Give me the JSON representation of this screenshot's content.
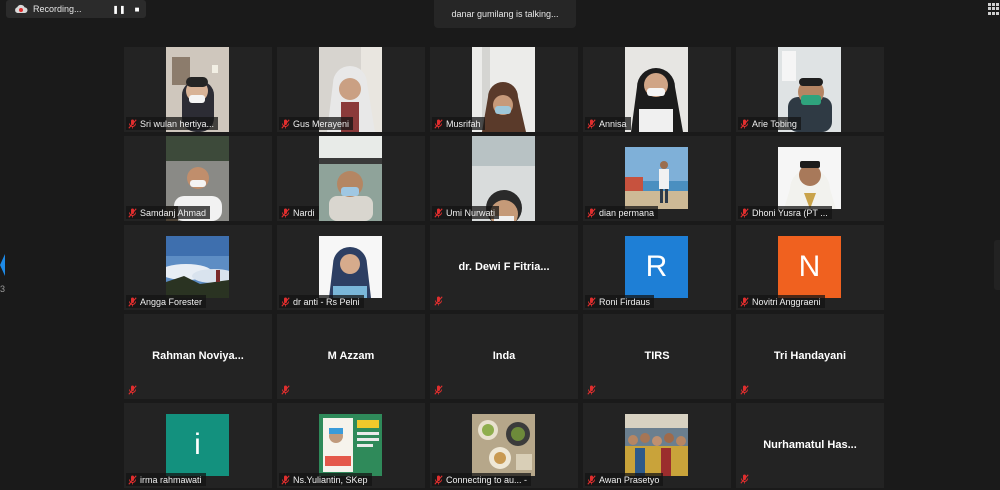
{
  "toolbar": {
    "recording_label": "Recording...",
    "pause_glyph": "❚❚",
    "stop_glyph": "■"
  },
  "talking_indicator": "danar gumilang is talking...",
  "page_indicator": "3",
  "colors": {
    "background": "#1a1a1a",
    "tile": "#232323",
    "muted_red": "#e02e2e",
    "avatar_blue": "#1e7fd6",
    "avatar_orange": "#f0611f",
    "avatar_teal": "#13917e"
  },
  "participants": [
    {
      "name": "Sri wulan hertiya...",
      "kind": "video",
      "scene": "room-lamp"
    },
    {
      "name": "Gus Merayeni",
      "kind": "video",
      "scene": "hijab-white"
    },
    {
      "name": "Musrifah",
      "kind": "video",
      "scene": "hijab-mask"
    },
    {
      "name": "Annisa",
      "kind": "video",
      "scene": "hijab-black"
    },
    {
      "name": "Arie Tobing",
      "kind": "video",
      "scene": "mask-green"
    },
    {
      "name": "Samdanj Ahmad",
      "kind": "video",
      "scene": "office"
    },
    {
      "name": "Nardi",
      "kind": "video",
      "scene": "car"
    },
    {
      "name": "Umi Nurwati",
      "kind": "video",
      "scene": "close-face"
    },
    {
      "name": "dian permana",
      "kind": "video-small",
      "scene": "beach"
    },
    {
      "name": "Dhoni Yusra (PT ...",
      "kind": "video-small",
      "scene": "portrait-white"
    },
    {
      "name": "Angga Forester",
      "kind": "video-small",
      "scene": "mountain"
    },
    {
      "name": "dr anti - Rs Pelni",
      "kind": "video-small",
      "scene": "portrait-hijab"
    },
    {
      "name": "",
      "display_name": "dr. Dewi F Fitria...",
      "kind": "name-only"
    },
    {
      "name": "Roni Firdaus",
      "kind": "avatar",
      "letter": "R",
      "color": "#1e7fd6"
    },
    {
      "name": "Novitri Anggraeni",
      "kind": "avatar",
      "letter": "N",
      "color": "#f0611f"
    },
    {
      "name": "",
      "display_name": "Rahman  Noviya...",
      "kind": "name-only"
    },
    {
      "name": "",
      "display_name": "M Azzam",
      "kind": "name-only"
    },
    {
      "name": "",
      "display_name": "Inda",
      "kind": "name-only"
    },
    {
      "name": "",
      "display_name": "TIRS",
      "kind": "name-only"
    },
    {
      "name": "",
      "display_name": "Tri Handayani",
      "kind": "name-only"
    },
    {
      "name": "irma rahmawati",
      "kind": "avatar",
      "letter": "i",
      "color": "#13917e"
    },
    {
      "name": "Ns.Yuliantin, SKep",
      "kind": "video-small",
      "scene": "poster"
    },
    {
      "name": "Connecting to au... -",
      "kind": "video-small",
      "scene": "food"
    },
    {
      "name": "Awan Prasetyo",
      "kind": "video-small",
      "scene": "crowd"
    },
    {
      "name": "",
      "display_name": "Nurhamatul  Has...",
      "kind": "name-only"
    }
  ]
}
